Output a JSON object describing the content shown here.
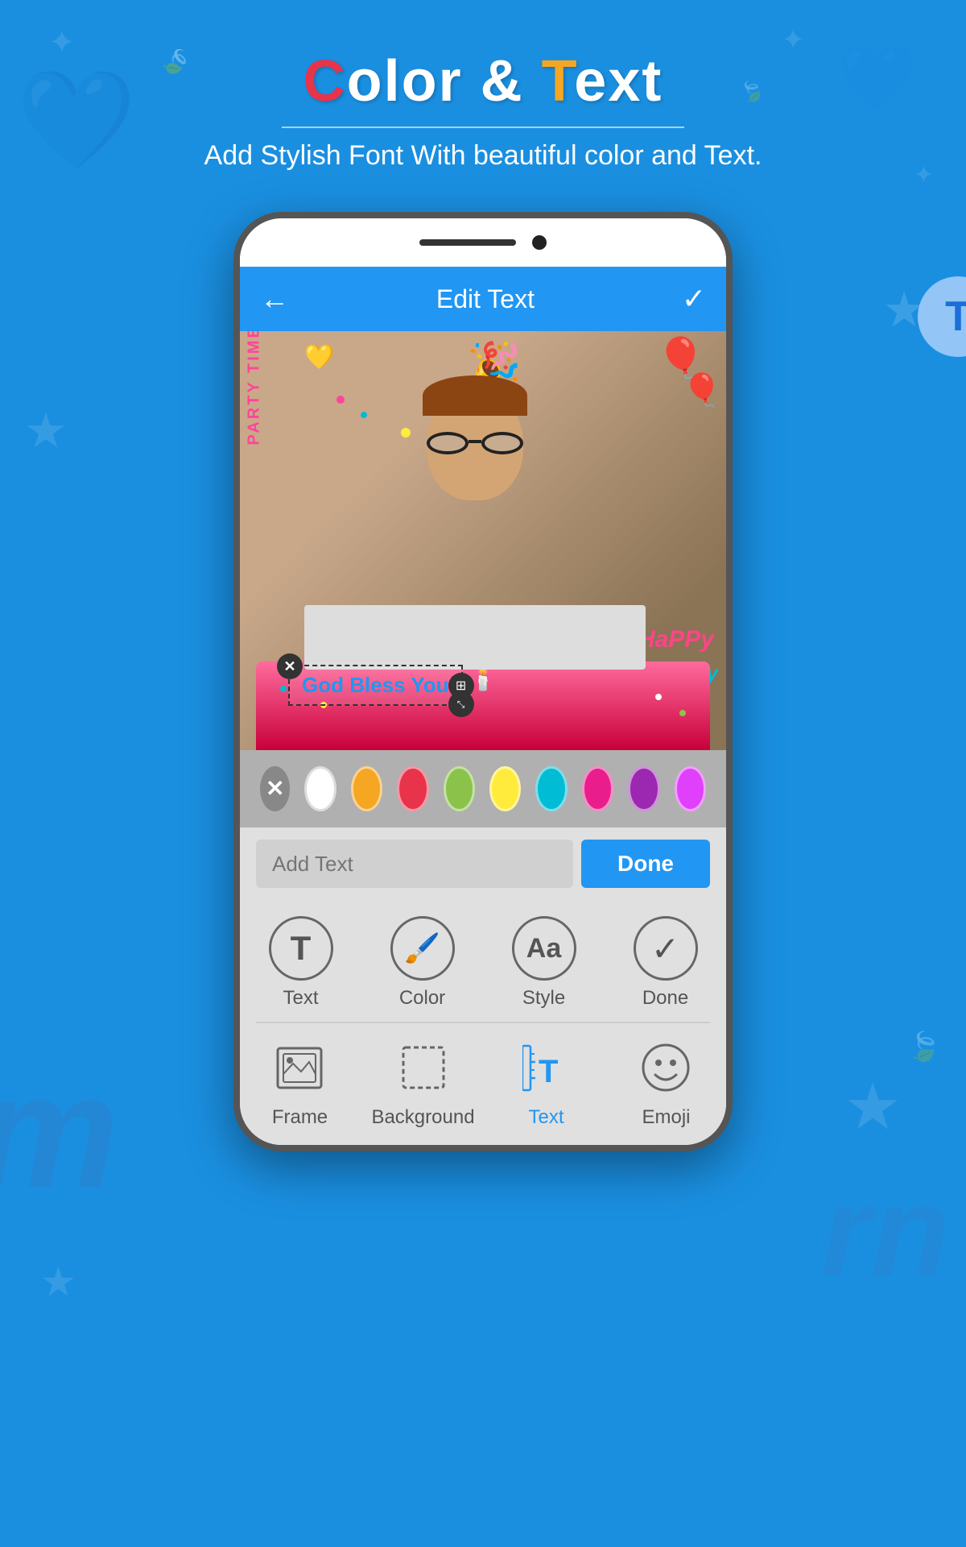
{
  "app": {
    "title": "Color & Text",
    "title_c": "C",
    "title_t": "T",
    "subtitle": "Add Stylish Font With beautiful color and Text.",
    "t_icon": "T"
  },
  "screen": {
    "header": {
      "back_icon": "←",
      "title": "Edit Text",
      "check_icon": "✓"
    },
    "text_overlay": "God Bless You",
    "happy_bday": "HaPPy",
    "birthday_text": "BiRtHday"
  },
  "color_picker": {
    "colors": [
      {
        "name": "x-close",
        "hex": "#888888",
        "is_x": true
      },
      {
        "name": "white",
        "hex": "#FFFFFF"
      },
      {
        "name": "orange",
        "hex": "#F5A623"
      },
      {
        "name": "red",
        "hex": "#E8334A"
      },
      {
        "name": "green",
        "hex": "#8BC34A"
      },
      {
        "name": "yellow",
        "hex": "#FFEB3B"
      },
      {
        "name": "cyan",
        "hex": "#00BCD4"
      },
      {
        "name": "pink",
        "hex": "#E91E8C"
      },
      {
        "name": "purple",
        "hex": "#9C27B0"
      },
      {
        "name": "magenta",
        "hex": "#E040FB"
      }
    ]
  },
  "text_input": {
    "placeholder": "Add Text",
    "done_label": "Done"
  },
  "toolbar_row1": [
    {
      "id": "text",
      "label": "Text",
      "symbol": "T",
      "active": false
    },
    {
      "id": "color",
      "label": "Color",
      "symbol": "🎨",
      "active": false
    },
    {
      "id": "style",
      "label": "Style",
      "symbol": "Aa",
      "active": false
    },
    {
      "id": "done",
      "label": "Done",
      "symbol": "✓",
      "active": false
    }
  ],
  "toolbar_row2": [
    {
      "id": "frame",
      "label": "Frame",
      "symbol": "🖼",
      "active": false
    },
    {
      "id": "background",
      "label": "Background",
      "symbol": "⬜",
      "active": false
    },
    {
      "id": "text2",
      "label": "Text",
      "symbol": "T",
      "active": true
    },
    {
      "id": "emoji",
      "label": "Emoji",
      "symbol": "😄",
      "active": false
    }
  ]
}
